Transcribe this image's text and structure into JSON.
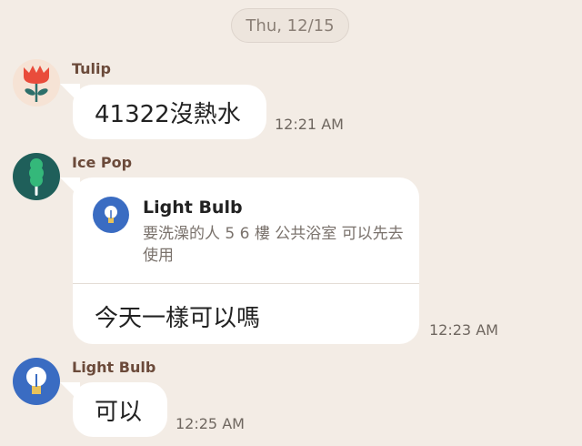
{
  "date_divider": "Thu, 12/15",
  "messages": [
    {
      "sender": "Tulip",
      "avatar_icon": "tulip-icon",
      "text": "41322沒熱水",
      "time": "12:21 AM"
    },
    {
      "sender": "Ice Pop",
      "avatar_icon": "ice-pop-icon",
      "reply_to": {
        "sender": "Light Bulb",
        "icon": "light-bulb-icon",
        "text": "要洗澡的人 5 6 樓 公共浴室 可以先去使用"
      },
      "text": "今天一樣可以嗎",
      "time": "12:23 AM"
    },
    {
      "sender": "Light Bulb",
      "avatar_icon": "light-bulb-icon",
      "text": "可以",
      "time": "12:25 AM"
    }
  ],
  "colors": {
    "background": "#f3ece5",
    "bubble": "#ffffff",
    "sender_name": "#6b4a3a",
    "tulip_avatar_bg": "#f6e3d5",
    "ice_pop_avatar_bg": "#1f5f5a",
    "light_bulb_avatar_bg": "#3a6cc2"
  }
}
